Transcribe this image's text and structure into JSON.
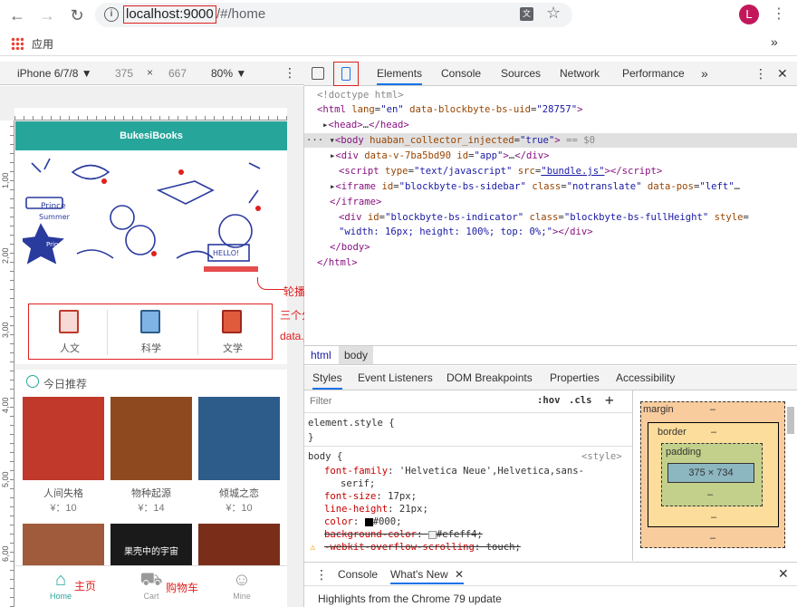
{
  "browser": {
    "url_host": "localhost:9000",
    "url_path": "/#/home",
    "bookmarks_label": "应用",
    "avatar_letter": "L"
  },
  "device": {
    "model": "iPhone 6/7/8 ▼",
    "width": "375",
    "height": "667",
    "zoom": "80% ▼"
  },
  "rulers": {
    "left_marks": [
      "1,00",
      "2,00",
      "3,00",
      "4,00",
      "5,00",
      "6,00"
    ]
  },
  "app": {
    "title": "BukesiBooks",
    "categories": [
      {
        "label": "人文",
        "icon": "clipboard-icon"
      },
      {
        "label": "科学",
        "icon": "notebook-icon"
      },
      {
        "label": "文学",
        "icon": "book-icon"
      }
    ],
    "recommend_title": "今日推荐",
    "books": [
      {
        "title": "人间失格",
        "price": "¥：10",
        "cover": "#c0392b"
      },
      {
        "title": "物种起源",
        "price": "¥：14",
        "cover": "#8e4a1e"
      },
      {
        "title": "倾城之恋",
        "price": "¥：10",
        "cover": "#2e5c8a"
      }
    ],
    "books_row2": [
      {
        "cover": "#a05a3c"
      },
      {
        "cover": "#1a1a1a",
        "text": "果壳中的宇宙"
      },
      {
        "cover": "#7a2e1a"
      }
    ],
    "tabs": [
      {
        "label": "Home",
        "icon": "home-icon",
        "active": true
      },
      {
        "label": "Cart",
        "icon": "cart-icon",
        "active": false
      },
      {
        "label": "Mine",
        "icon": "user-icon",
        "active": false
      }
    ]
  },
  "annotations": {
    "swipe": "轮播图对应swipes",
    "categories_1": "三个分类，对应mock文件夹中",
    "categories_2": "data.json文件中categories",
    "home": "主页",
    "cart": "购物车"
  },
  "devtools": {
    "tabs": [
      "Elements",
      "Console",
      "Sources",
      "Network",
      "Performance"
    ],
    "breadcrumbs": [
      "html",
      "body"
    ],
    "subtabs": [
      "Styles",
      "Event Listeners",
      "DOM Breakpoints",
      "Properties",
      "Accessibility"
    ],
    "filter_placeholder": "Filter",
    "hov": ":hov",
    "cls": ".cls",
    "box": {
      "margin": "margin",
      "border": "border",
      "padding": "padding",
      "content": "375 × 734",
      "dash": "–"
    },
    "drawer_tabs": [
      "Console",
      "What's New"
    ],
    "drawer_text": "Highlights from the Chrome 79 update"
  }
}
